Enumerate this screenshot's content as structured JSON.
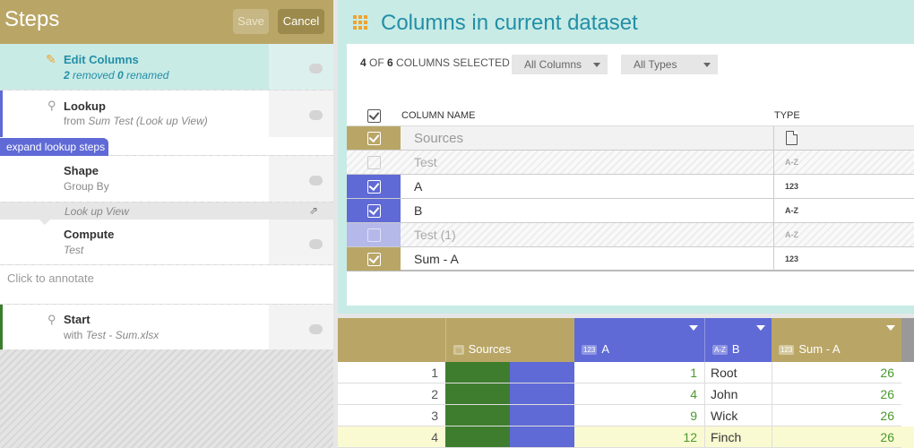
{
  "steps_panel": {
    "title": "Steps",
    "save_label": "Save",
    "cancel_label": "Cancel",
    "steps": [
      {
        "name": "Edit Columns",
        "removed_count": "2",
        "removed_text": " removed ",
        "renamed_count": "0",
        "renamed_text": " renamed"
      },
      {
        "name": "Lookup",
        "sub_prefix": "from ",
        "sub_italic": "Sum Test (Look up View)",
        "tag": "expand lookup steps"
      },
      {
        "name": "Shape",
        "sub": "Group By"
      },
      {
        "group_label": "Look up View"
      },
      {
        "name": "Compute",
        "sub_italic": "Test"
      },
      {
        "annotate": "Click to annotate"
      },
      {
        "name": "Start",
        "sub_prefix": "with ",
        "sub_italic": "Test - Sum.xlsx"
      }
    ],
    "colors": {
      "header": "#b9a666",
      "active": "#c9ebe6",
      "lookup_bar": "#5f6ad6",
      "start_bar": "#3a7d2c"
    }
  },
  "columns_panel": {
    "title": "Columns in current dataset",
    "selected_count": "4",
    "of_text": " OF ",
    "total_count": "6",
    "selected_suffix": " COLUMNS SELECTED",
    "filter_columns": "All Columns",
    "filter_types": "All Types",
    "header_name": "COLUMN NAME",
    "header_type": "TYPE",
    "rows": [
      {
        "name": "Sources",
        "type": "doc",
        "checked": true,
        "color": "#b9a666",
        "state": "source"
      },
      {
        "name": "Test",
        "type": "A-Z",
        "checked": false,
        "state": "disabled"
      },
      {
        "name": "A",
        "type": "123",
        "checked": true,
        "color": "#5f6ad6"
      },
      {
        "name": "B",
        "type": "A-Z",
        "checked": true,
        "color": "#5f6ad6"
      },
      {
        "name": "Test (1)",
        "type": "A-Z",
        "checked": false,
        "state": "disabled"
      },
      {
        "name": "Sum - A",
        "type": "123",
        "checked": true,
        "color": "#b9a666"
      }
    ]
  },
  "data_grid": {
    "columns": [
      {
        "name": "Sources",
        "badge": "doc"
      },
      {
        "name": "A",
        "badge": "123"
      },
      {
        "name": "B",
        "badge": "A-Z"
      },
      {
        "name": "Sum - A",
        "badge": "123"
      }
    ],
    "rows": [
      {
        "n": "1",
        "a": "1",
        "b": "Root",
        "sum": "26"
      },
      {
        "n": "2",
        "a": "4",
        "b": "John",
        "sum": "26"
      },
      {
        "n": "3",
        "a": "9",
        "b": "Wick",
        "sum": "26"
      },
      {
        "n": "4",
        "a": "12",
        "b": "Finch",
        "sum": "26"
      }
    ]
  }
}
